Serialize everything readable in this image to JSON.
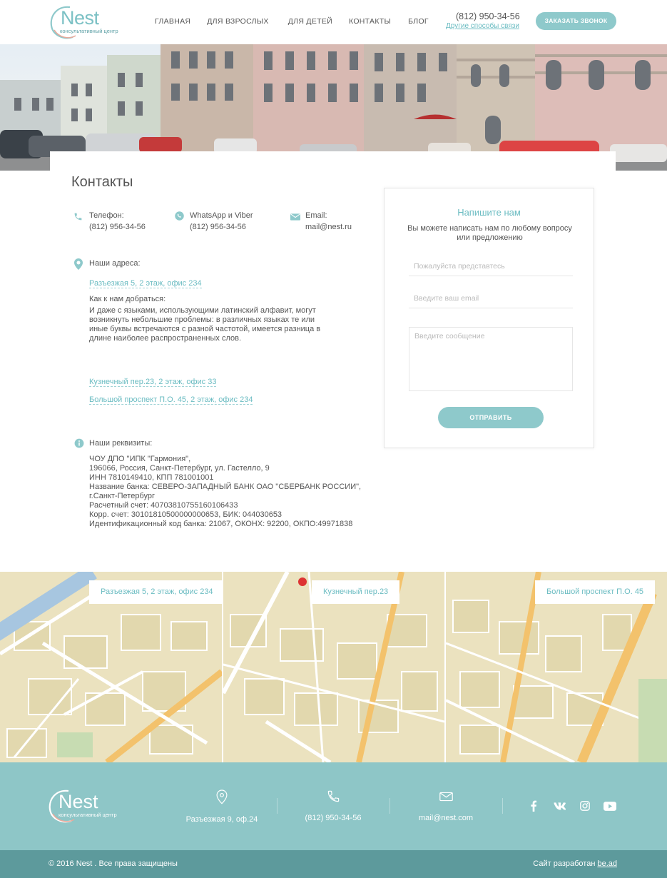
{
  "header": {
    "logo_word": "Nest",
    "logo_sub": "консультативный центр",
    "nav": [
      "ГЛАВНАЯ",
      "ДЛЯ ВЗРОСЛЫХ",
      "ДЛЯ ДЕТЕЙ",
      "КОНТАКТЫ",
      "БЛОГ"
    ],
    "phone": "(812) 950-34-56",
    "other_ways": "Другие способы связи",
    "call_button": "ЗАКАЗАТЬ ЗВОНОК"
  },
  "contacts": {
    "title": "Контакты",
    "phone_label": "Телефон:",
    "phone_value": "(812) 956-34-56",
    "whatsapp_label": "WhatsApp и Viber",
    "whatsapp_value": "(812) 956-34-56",
    "email_label": "Email:",
    "email_value": "mail@nest.ru",
    "addresses_label": "Наши адреса:",
    "address_1": "Разъезжая 5, 2 этаж, офис 234",
    "howto_title": "Как к нам добраться:",
    "howto_text": "И даже с языками, использующими латинский алфавит, могут возникнуть небольшие проблемы: в различных языках те или иные буквы встречаются с разной частотой, имеется разница в длине наиболее распространенных слов.",
    "address_2": "Кузнечный пер.23, 2 этаж, офис 33",
    "address_3": "Большой проспект П.О. 45, 2 этаж, офис 234",
    "requisites_label": "Наши реквизиты:",
    "requisites": [
      "ЧОУ ДПО \"ИПК \"Гармония\",",
      "196066, Россия, Санкт-Петербург, ул. Гастелло, 9",
      "ИНН 7810149410, КПП 781001001",
      "Название банка: СЕВЕРО-ЗАПАДНЫЙ БАНК ОАО \"СБЕРБАНК РОССИИ\",",
      "г.Санкт-Петербург",
      "Расчетный счет: 40703810755160106433",
      "Корр. счет: 30101810500000000653, БИК: 044030653",
      "Идентификационный код банка: 21067, ОКОНХ: 92200, ОКПО:49971838"
    ]
  },
  "form": {
    "title": "Напишите нам",
    "desc": "Вы можете написать нам по любому вопросу или предложению",
    "name_placeholder": "Пожалуйста представтесь",
    "email_placeholder": "Введите ваш email",
    "message_placeholder": "Введите сообщение",
    "submit": "ОТПРАВИТЬ"
  },
  "maps": [
    {
      "label": "Разъезжая 5, 2 этаж, офис 234"
    },
    {
      "label": "Кузнечный пер.23"
    },
    {
      "label": "Большой проспект П.О. 45"
    }
  ],
  "footer": {
    "logo_word": "Nest",
    "logo_sub": "консультативный центр",
    "address": "Разъезжая 9, оф.24",
    "phone": "(812) 950-34-56",
    "email": "mail@nest.com",
    "copyright": "© 2016 Nest . Все права защищены",
    "dev_text": "Сайт разработан",
    "dev_link": "be.ad"
  },
  "colors": {
    "accent": "#8ec9cb",
    "link": "#6bbcc2",
    "footer": "#8ec6c7",
    "footer_bottom": "#5d9a9c"
  }
}
